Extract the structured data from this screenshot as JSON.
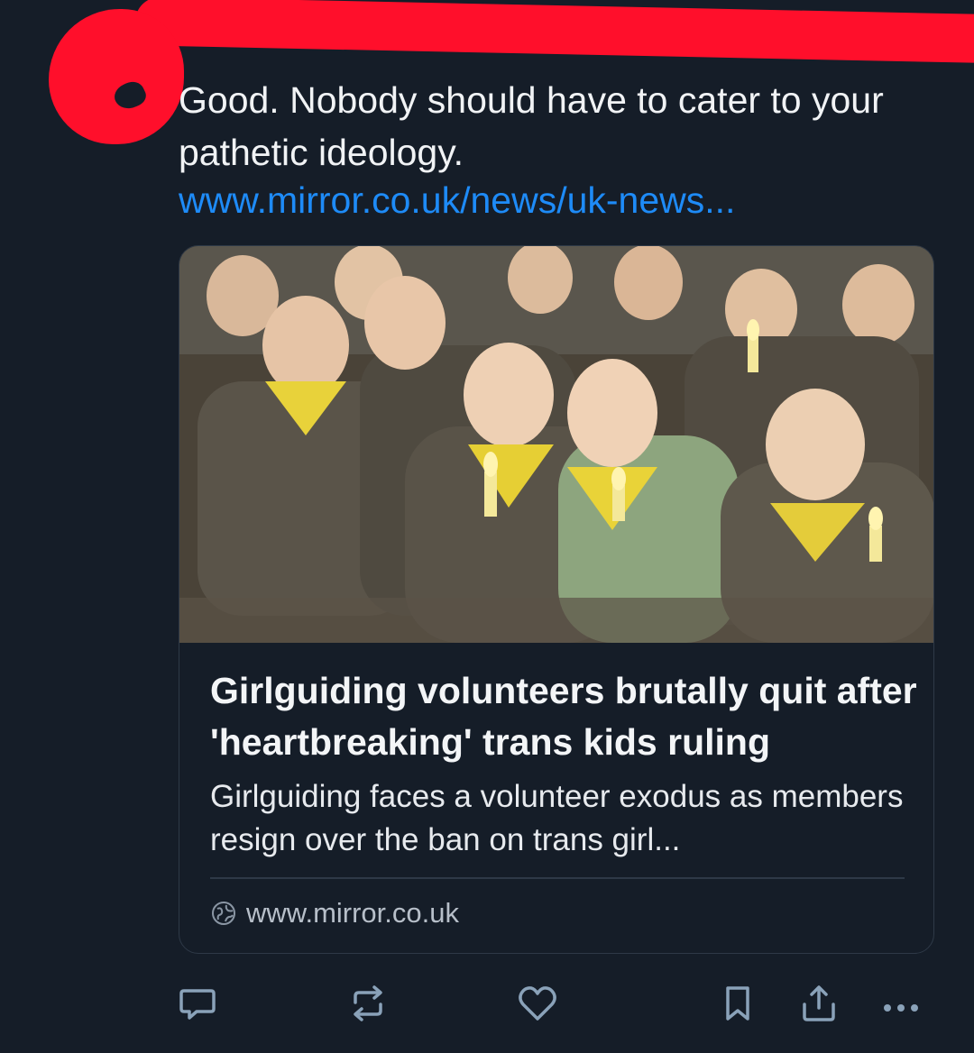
{
  "post": {
    "text": "Good. Nobody should have to cater to your pathetic ideology.",
    "link": "www.mirror.co.uk/news/uk-news..."
  },
  "card": {
    "image_alt": "Group of young Girlguiding members in uniforms holding candles",
    "title": "Girlguiding volunteers brutally quit after 'heartbreaking' trans kids ruling",
    "description": "Girlguiding faces a volunteer exodus as members resign over the ban on trans girl...",
    "domain": "www.mirror.co.uk"
  },
  "icons": {
    "reply": "reply-icon",
    "repost": "repost-icon",
    "like": "heart-icon",
    "bookmark": "bookmark-icon",
    "share": "share-icon",
    "more": "more-icon",
    "globe": "globe-icon"
  },
  "colors": {
    "background": "#151d28",
    "link": "#1e8bf7",
    "redaction": "#ff0f2b",
    "icon": "#8aa2b9"
  }
}
